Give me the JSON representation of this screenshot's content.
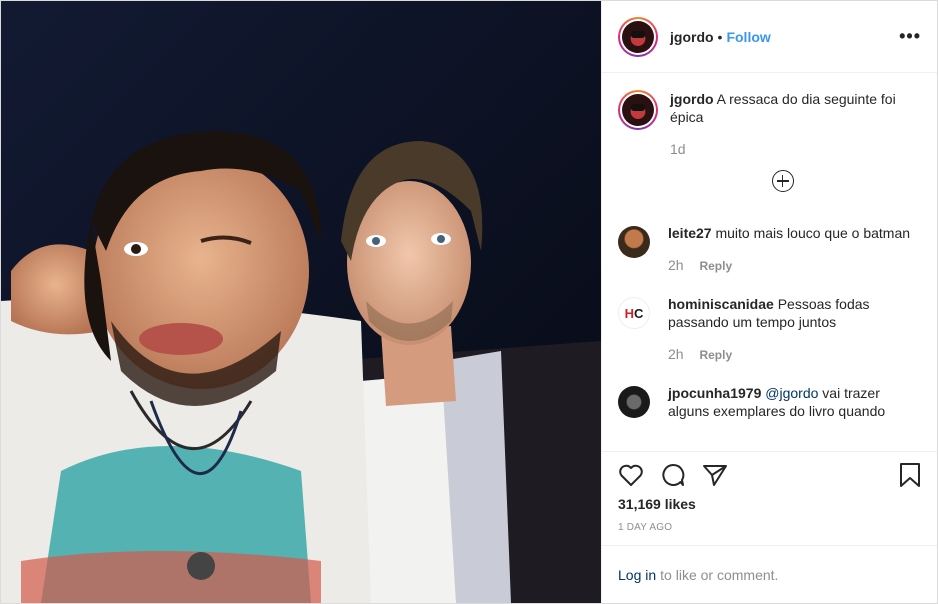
{
  "author": {
    "username": "jgordo",
    "separator": "•",
    "follow_label": "Follow",
    "more_label": "•••"
  },
  "caption": {
    "username": "jgordo",
    "text": "A ressaca do dia seguinte foi épica",
    "time": "1d"
  },
  "comments": [
    {
      "username": "leite27",
      "text": "muito mais louco que o batman",
      "time": "2h",
      "reply_label": "Reply"
    },
    {
      "username": "hominiscanidae",
      "text": "Pessoas fodas passando um tempo juntos",
      "time": "2h",
      "reply_label": "Reply"
    },
    {
      "username": "jpocunha1979",
      "mention": "@jgordo",
      "text": "vai trazer alguns exemplares do livro quando"
    }
  ],
  "avatar_hc": {
    "h": "H",
    "c": "C"
  },
  "likes": "31,169 likes",
  "timestamp": "1 DAY AGO",
  "login": {
    "link": "Log in",
    "text": "to like or comment."
  },
  "icons": [
    "heart-icon",
    "comment-icon",
    "share-icon",
    "bookmark-icon",
    "add-comment-icon"
  ],
  "colors": {
    "link": "#3897f0",
    "mention": "#003569",
    "muted": "#8e8e8e"
  }
}
